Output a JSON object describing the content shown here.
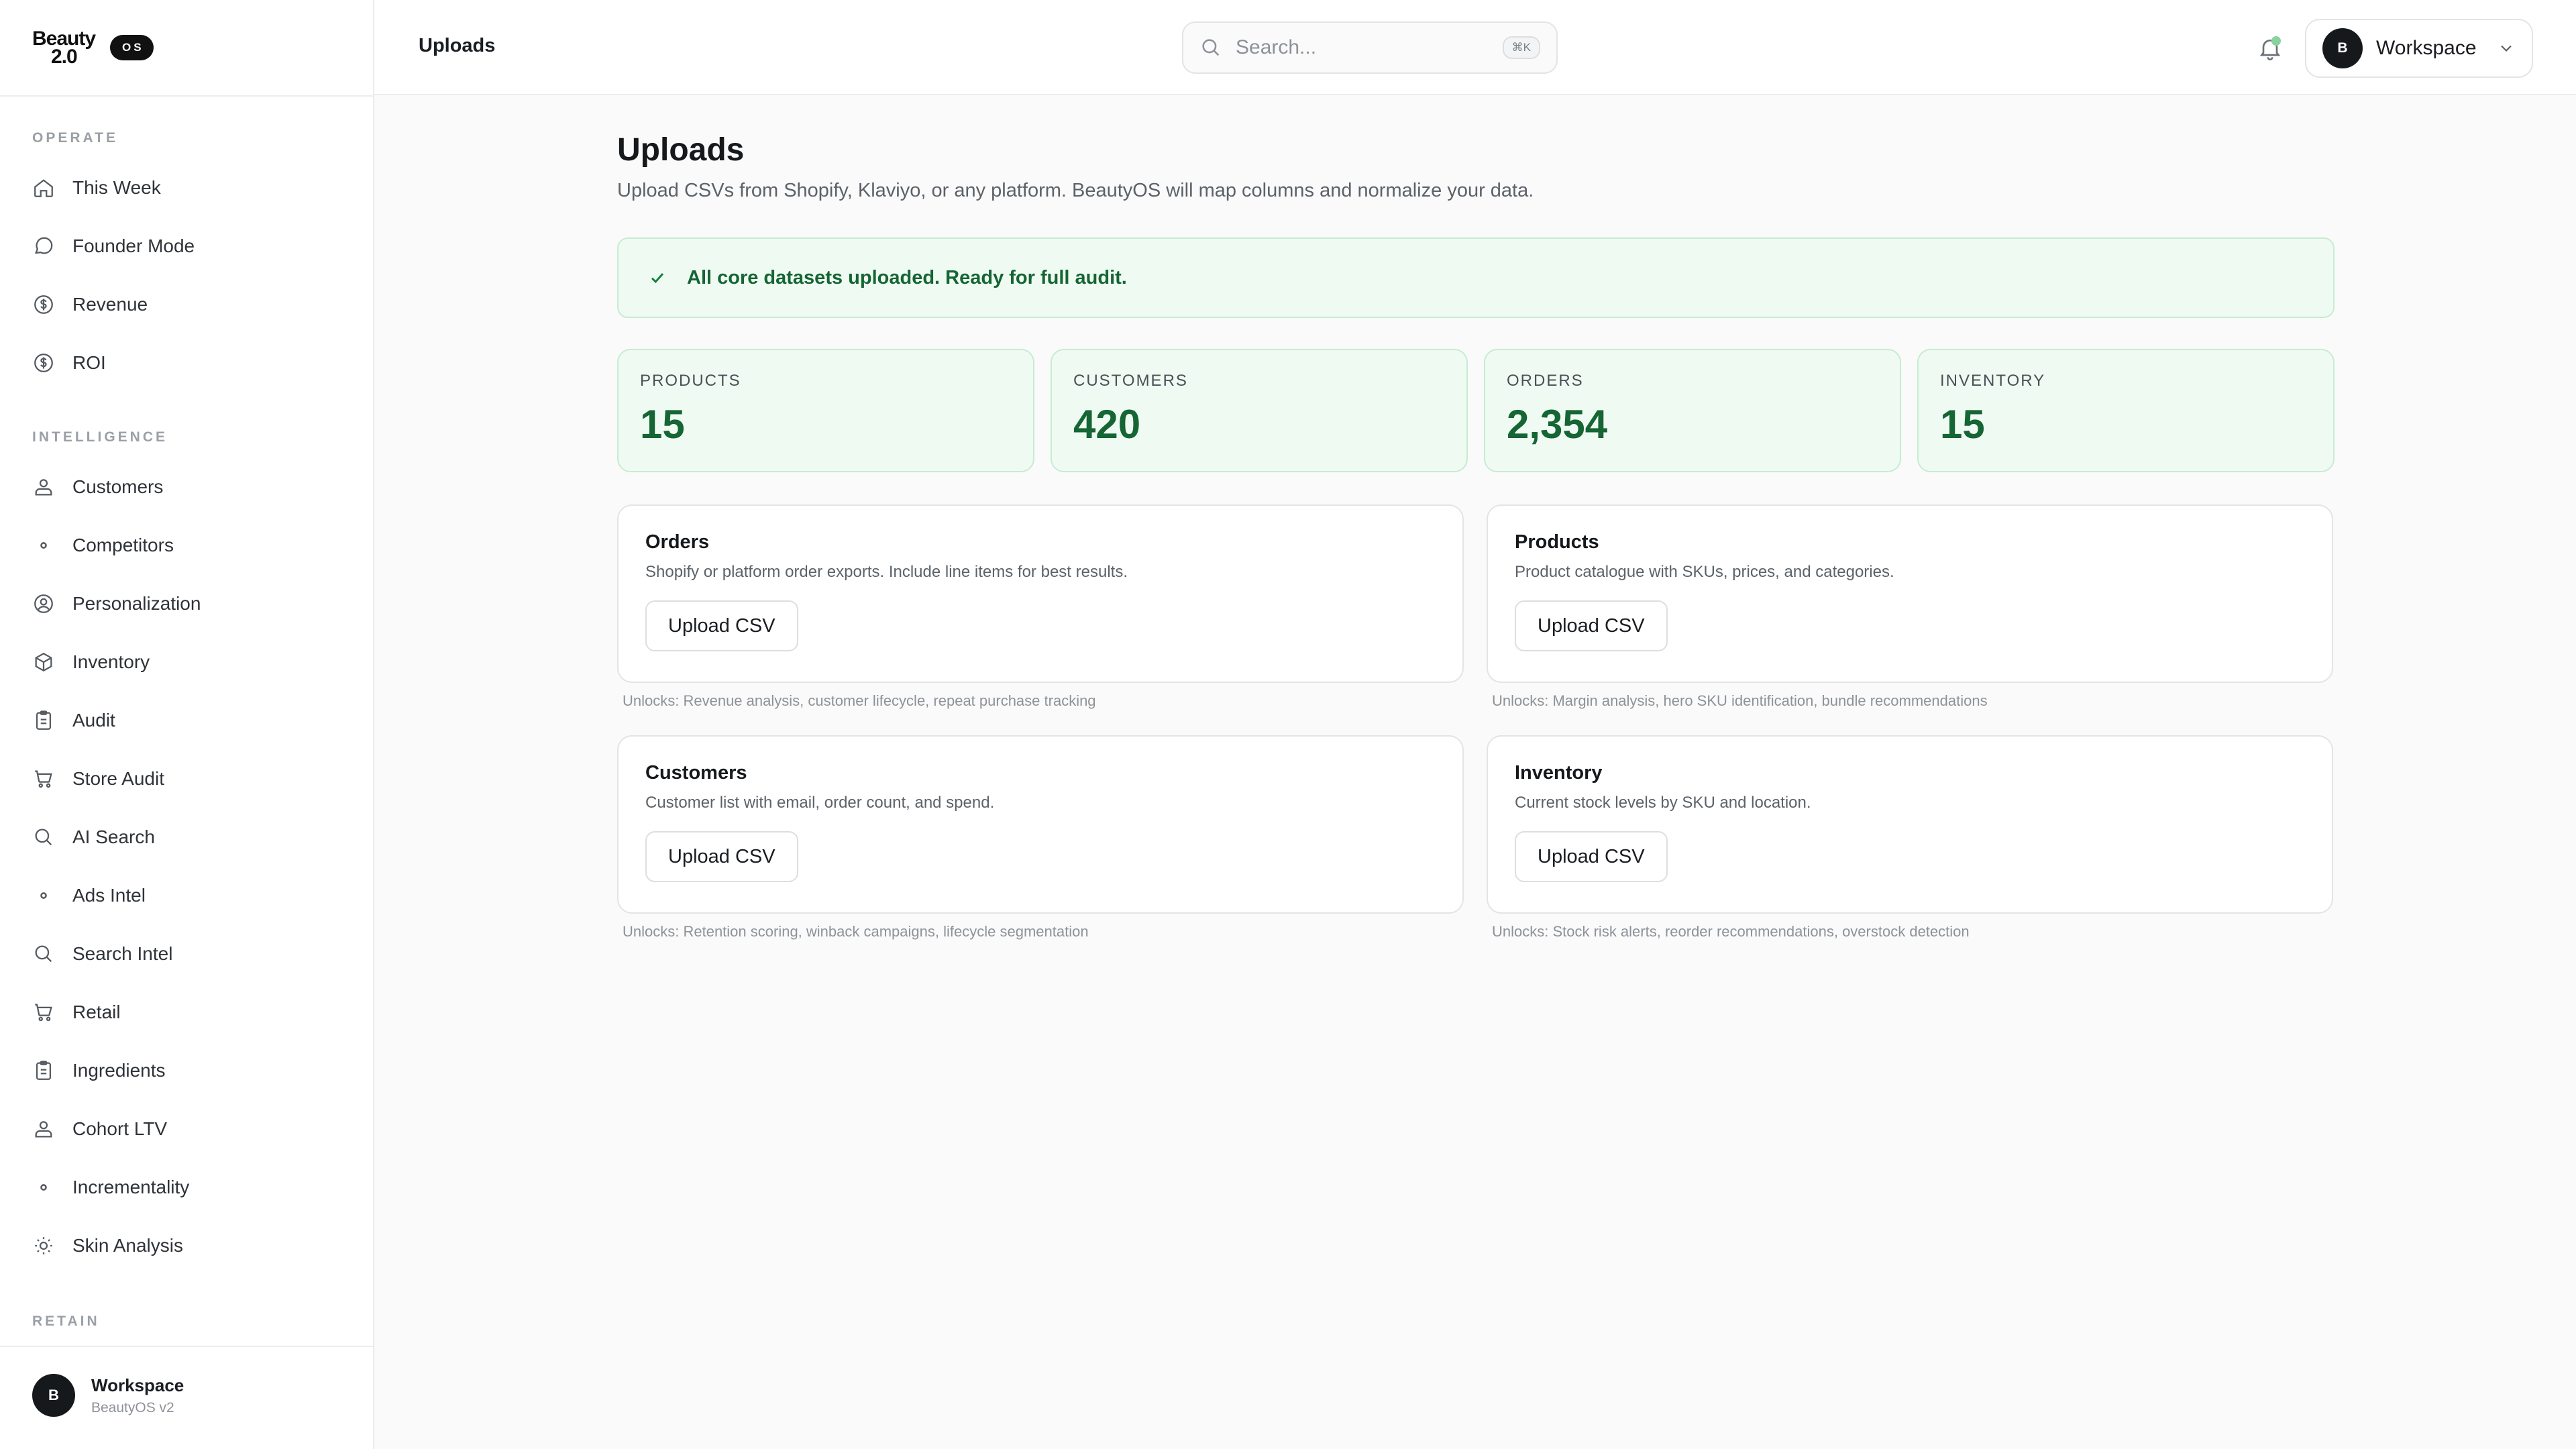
{
  "brand": {
    "line1": "Beauty",
    "line2": "2.0",
    "badge": "OS"
  },
  "sidebar": {
    "sections": [
      {
        "label": "OPERATE",
        "items": [
          {
            "label": "This Week",
            "icon": "home-icon"
          },
          {
            "label": "Founder Mode",
            "icon": "message-icon"
          },
          {
            "label": "Revenue",
            "icon": "dollar-icon"
          },
          {
            "label": "ROI",
            "icon": "dollar-icon"
          }
        ]
      },
      {
        "label": "INTELLIGENCE",
        "items": [
          {
            "label": "Customers",
            "icon": "users-icon"
          },
          {
            "label": "Competitors",
            "icon": "dot-icon"
          },
          {
            "label": "Personalization",
            "icon": "user-circle-icon"
          },
          {
            "label": "Inventory",
            "icon": "box-icon"
          },
          {
            "label": "Audit",
            "icon": "clipboard-icon"
          },
          {
            "label": "Store Audit",
            "icon": "cart-icon"
          },
          {
            "label": "AI Search",
            "icon": "search-icon"
          },
          {
            "label": "Ads Intel",
            "icon": "dot-icon"
          },
          {
            "label": "Search Intel",
            "icon": "search-icon"
          },
          {
            "label": "Retail",
            "icon": "cart-icon"
          },
          {
            "label": "Ingredients",
            "icon": "clipboard-icon"
          },
          {
            "label": "Cohort LTV",
            "icon": "users-icon"
          },
          {
            "label": "Incrementality",
            "icon": "dot-icon"
          },
          {
            "label": "Skin Analysis",
            "icon": "sun-icon"
          }
        ]
      },
      {
        "label": "RETAIN",
        "items": []
      }
    ],
    "footer": {
      "avatar": "B",
      "name": "Workspace",
      "sub": "BeautyOS v2"
    }
  },
  "header": {
    "title": "Uploads",
    "search_placeholder": "Search...",
    "search_shortcut": "⌘K",
    "workspace": {
      "avatar": "B",
      "label": "Workspace"
    }
  },
  "main": {
    "title": "Uploads",
    "subtitle": "Upload CSVs from Shopify, Klaviyo, or any platform. BeautyOS will map columns and normalize your data.",
    "banner": "All core datasets uploaded. Ready for full audit.",
    "stats": [
      {
        "label": "PRODUCTS",
        "value": "15"
      },
      {
        "label": "CUSTOMERS",
        "value": "420"
      },
      {
        "label": "ORDERS",
        "value": "2,354"
      },
      {
        "label": "INVENTORY",
        "value": "15"
      }
    ],
    "cards": [
      {
        "title": "Orders",
        "desc": "Shopify or platform order exports. Include line items for best results.",
        "button": "Upload CSV",
        "unlocks": "Unlocks: Revenue analysis, customer lifecycle, repeat purchase tracking"
      },
      {
        "title": "Products",
        "desc": "Product catalogue with SKUs, prices, and categories.",
        "button": "Upload CSV",
        "unlocks": "Unlocks: Margin analysis, hero SKU identification, bundle recommendations"
      },
      {
        "title": "Customers",
        "desc": "Customer list with email, order count, and spend.",
        "button": "Upload CSV",
        "unlocks": "Unlocks: Retention scoring, winback campaigns, lifecycle segmentation"
      },
      {
        "title": "Inventory",
        "desc": "Current stock levels by SKU and location.",
        "button": "Upload CSV",
        "unlocks": "Unlocks: Stock risk alerts, reorder recommendations, overstock detection"
      }
    ]
  },
  "colors": {
    "accent_green": "#166534",
    "success_bg": "#effbf2",
    "success_border": "#c6ecd1",
    "dark": "#16191c"
  }
}
